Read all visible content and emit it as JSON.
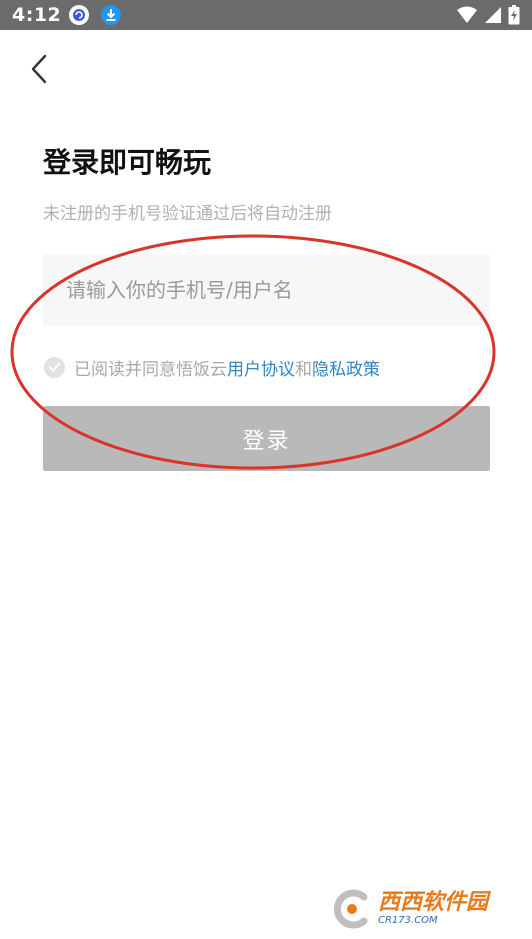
{
  "status_bar": {
    "time": "4:12",
    "icons": [
      "message-notification-icon",
      "download-icon",
      "wifi-icon",
      "signal-icon",
      "battery-charging-icon"
    ]
  },
  "header": {
    "back_icon": "chevron-left-icon"
  },
  "login": {
    "title": "登录即可畅玩",
    "subtitle": "未注册的手机号验证通过后将自动注册",
    "phone_placeholder": "请输入你的手机号/用户名",
    "phone_value": "",
    "agreement": {
      "prefix": "已阅读并同意悟饭云",
      "user_agreement": "用户协议",
      "conjunction": "和",
      "privacy_policy": "隐私政策",
      "checked": false
    },
    "submit_label": "登录"
  },
  "annotation": {
    "color": "#d9342b",
    "shape": "ellipse"
  },
  "watermark": {
    "text": "西西软件园",
    "sub": "CR173.COM",
    "colors": {
      "main": "#e87a1c",
      "sub": "#2a6fb8"
    }
  },
  "colors": {
    "status_bar": "#6b6b6b",
    "link": "#2f86c8",
    "button_disabled": "#b9b9b9",
    "input_bg": "#f7f7f7"
  }
}
